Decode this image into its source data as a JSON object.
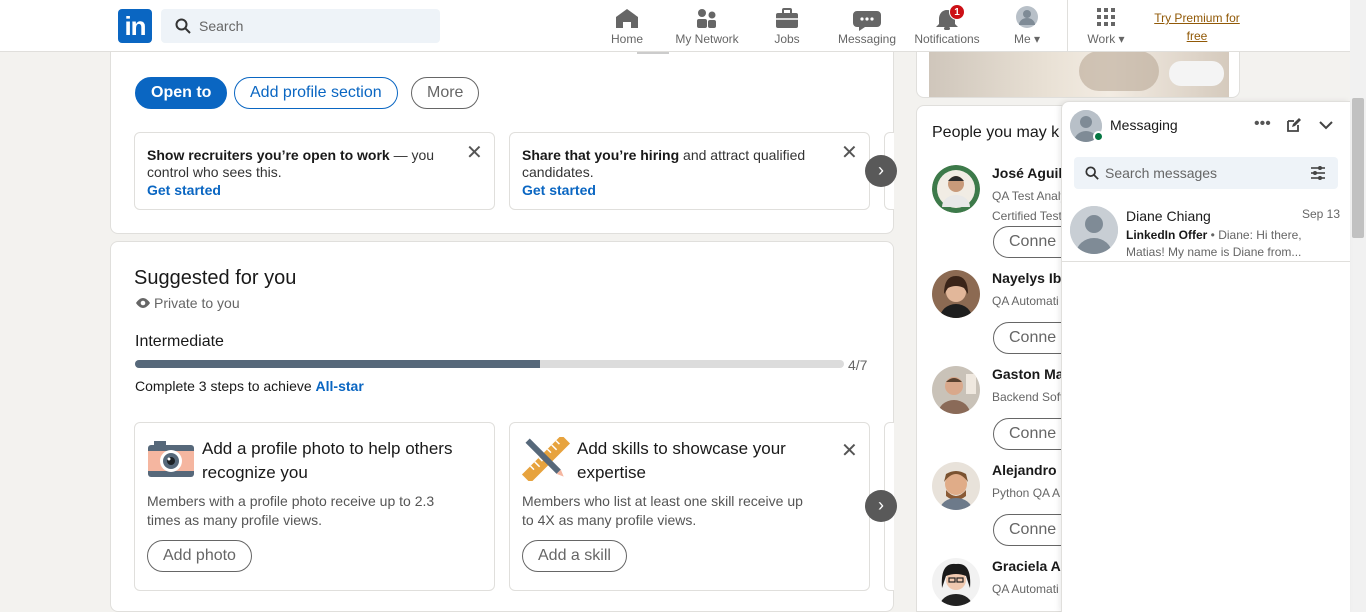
{
  "header": {
    "logo_text": "in",
    "search_placeholder": "Search",
    "nav": [
      {
        "label": "Home",
        "icon": "home-icon"
      },
      {
        "label": "My Network",
        "icon": "network-icon"
      },
      {
        "label": "Jobs",
        "icon": "briefcase-icon"
      },
      {
        "label": "Messaging",
        "icon": "messaging-icon"
      },
      {
        "label": "Notifications",
        "icon": "bell-icon",
        "badge": "1"
      },
      {
        "label": "Me",
        "icon": "avatar"
      },
      {
        "label": "Work",
        "icon": "grid-icon"
      }
    ],
    "premium_line1": "Try Premium for",
    "premium_line2": "free"
  },
  "profile_actions": {
    "open_to": "Open to",
    "add_section": "Add profile section",
    "more": "More"
  },
  "promo_cards": [
    {
      "text_bold": "Show recruiters you’re open to work",
      "text_rest": " — you control who sees this.",
      "link": "Get started"
    },
    {
      "text_bold": "Share that you’re hiring",
      "text_rest": " and attract qualified candidates.",
      "link": "Get started"
    }
  ],
  "suggested": {
    "title": "Suggested for you",
    "privacy": "Private to you",
    "level": "Intermediate",
    "progress": {
      "done": 4,
      "total": 7,
      "label": "4/7"
    },
    "complete_text": "Complete 3 steps to achieve ",
    "complete_link": "All-star",
    "tasks": [
      {
        "title": "Add a profile photo to help others recognize you",
        "desc": "Members with a profile photo receive up to 2.3 times as many profile views.",
        "button": "Add photo",
        "icon": "camera-icon"
      },
      {
        "title": "Add skills to showcase your expertise",
        "desc": "Members who list at least one skill receive up to 4X as many profile views.",
        "button": "Add a skill",
        "icon": "pencil-ruler-icon"
      }
    ]
  },
  "people": {
    "title": "People you may k",
    "connect_label": "Conne",
    "items": [
      {
        "name": "José Aguila",
        "headline1": "QA Test Analy",
        "headline2": "Certified Test"
      },
      {
        "name": "Nayelys Iba",
        "headline1": "QA Automati",
        "headline2": ""
      },
      {
        "name": "Gaston Ma",
        "headline1": "Backend Soft",
        "headline2": ""
      },
      {
        "name": "Alejandro I",
        "headline1": "Python QA A",
        "headline2": ""
      },
      {
        "name": "Graciela Ar",
        "headline1": "QA Automati",
        "headline2": ""
      }
    ]
  },
  "messaging": {
    "title": "Messaging",
    "search_placeholder": "Search messages",
    "conversations": [
      {
        "name": "Diane Chiang",
        "date": "Sep 13",
        "sender": "LinkedIn Offer",
        "preview": "Diane: Hi there, Matias! My name is Diane from..."
      }
    ]
  },
  "colors": {
    "brand": "#0a66c2",
    "badge": "#cc1016",
    "premium": "#915907",
    "online": "#057642"
  }
}
